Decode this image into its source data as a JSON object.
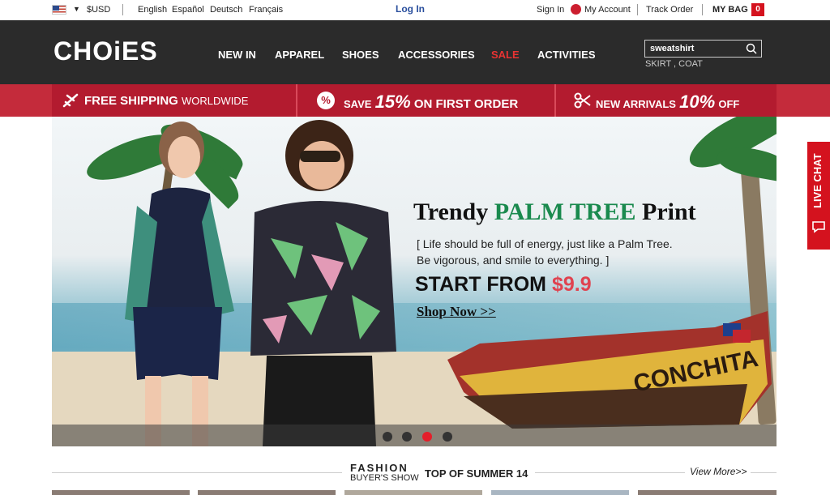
{
  "topbar": {
    "currency": "$USD",
    "languages": [
      "English",
      "Español",
      "Deutsch",
      "Français"
    ],
    "login": "Log In",
    "sign_in": "Sign In",
    "my_account": "My Account",
    "track_order": "Track Order",
    "my_bag": "MY BAG",
    "bag_count": "0"
  },
  "header": {
    "logo": "CHOiES",
    "nav": [
      "NEW IN",
      "APPAREL",
      "SHOES",
      "ACCESSORIES",
      "SALE",
      "ACTIVITIES"
    ],
    "search": {
      "value": "sweatshirt"
    },
    "hot_search": "SKIRT , COAT"
  },
  "promo": {
    "shipping_bold": "FREE SHIPPING",
    "shipping_rest": "WORLDWIDE",
    "save_pre": "SAVE",
    "save_pct": "15%",
    "save_post": "ON FIRST ORDER",
    "arrivals_pre": "NEW ARRIVALS",
    "arrivals_pct": "10%",
    "arrivals_post": "OFF"
  },
  "hero": {
    "headline_pre": "Trendy",
    "headline_green": "PALM TREE",
    "headline_post": "Print",
    "sub_line1": "[ Life should be full of energy, just like a Palm Tree.",
    "sub_line2": "Be vigorous, and smile to everything. ]",
    "start_label": "START FROM",
    "price": "$9.9",
    "shop_now": "Shop Now >>",
    "boat_name": "CONCHITA",
    "slide_count": 4,
    "active_slide": 3
  },
  "livechat": {
    "label": "LIVE CHAT"
  },
  "section": {
    "fashion": "FASHION",
    "buyers_show": "BUYER'S SHOW",
    "top_of": "TOP OF SUMMER 14",
    "view_more": "View More>>"
  },
  "colors": {
    "header_bg": "#2b2b2b",
    "promo_red": "#b31b2f",
    "sale_red": "#e83333",
    "accent_green": "#1a8a4e",
    "price_pink": "#e0424f"
  }
}
